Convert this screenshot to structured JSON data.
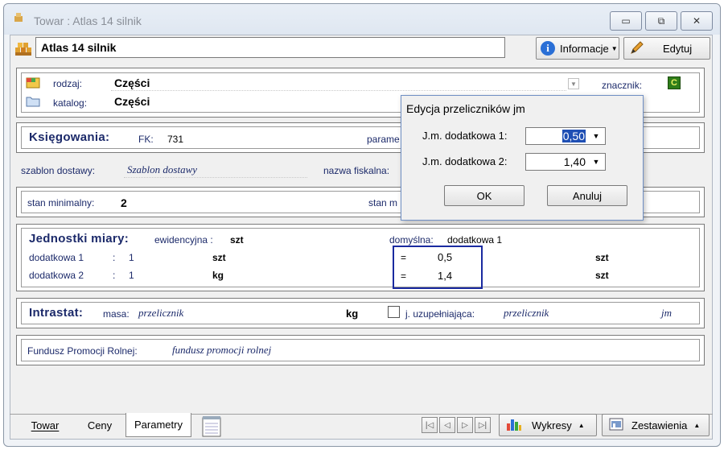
{
  "window": {
    "title": "Towar : Atlas 14 silnik",
    "minimize_glyph": "▭",
    "restore_glyph": "⧉",
    "close_glyph": "✕"
  },
  "header": {
    "name": "Atlas 14 silnik",
    "info_label": "Informacje",
    "edit_label": "Edytuj"
  },
  "section1": {
    "rodzaj_label": "rodzaj:",
    "rodzaj_value": "Części",
    "katalog_label": "katalog:",
    "katalog_value": "Części",
    "znacznik_label": "znacznik:",
    "znacznik_value": "C"
  },
  "ksiegowania": {
    "title": "Księgowania:",
    "fk_label": "FK:",
    "fk_value": "731",
    "param_label": "parame"
  },
  "row_szablon": {
    "szablon_label": "szablon dostawy:",
    "szablon_value": "Szablon dostawy",
    "nazwa_label": "nazwa fiskalna:"
  },
  "stan": {
    "min_label": "stan minimalny:",
    "min_value": "2",
    "stan_m_label": "stan m"
  },
  "jednostki": {
    "title": "Jednostki miary:",
    "ewid_label": "ewidencyjna :",
    "ewid_value": "szt",
    "domyslna_label": "domyślna:",
    "domyslna_value": "dodatkowa 1",
    "rows": [
      {
        "label": "dodatkowa 1",
        "sep": ":",
        "num": "1",
        "unit": "szt",
        "eq": "=",
        "conv": "0,5",
        "base": "szt"
      },
      {
        "label": "dodatkowa 2",
        "sep": ":",
        "num": "1",
        "unit": "kg",
        "eq": "=",
        "conv": "1,4",
        "base": "szt"
      }
    ]
  },
  "intrastat": {
    "title": "Intrastat:",
    "masa_label": "masa:",
    "masa_value": "przelicznik",
    "unit": "kg",
    "jm_label": "j. uzupełniająca:",
    "jm_value": "przelicznik",
    "jm_unit": "jm"
  },
  "fundusz": {
    "label": "Fundusz Promocji Rolnej:",
    "value": "fundusz promocji rolnej"
  },
  "dialog": {
    "title": "Edycja przeliczników jm",
    "field1_label": "J.m. dodatkowa 1:",
    "field1_value": "0,50",
    "field2_label": "J.m. dodatkowa 2:",
    "field2_value": "1,40",
    "ok_label": "OK",
    "cancel_label": "Anuluj"
  },
  "tabs": [
    {
      "label": "Towar"
    },
    {
      "label": "Ceny"
    },
    {
      "label": "Parametry"
    }
  ],
  "bottom": {
    "wykresy_label": "Wykresy",
    "zestawienia_label": "Zestawienia"
  }
}
